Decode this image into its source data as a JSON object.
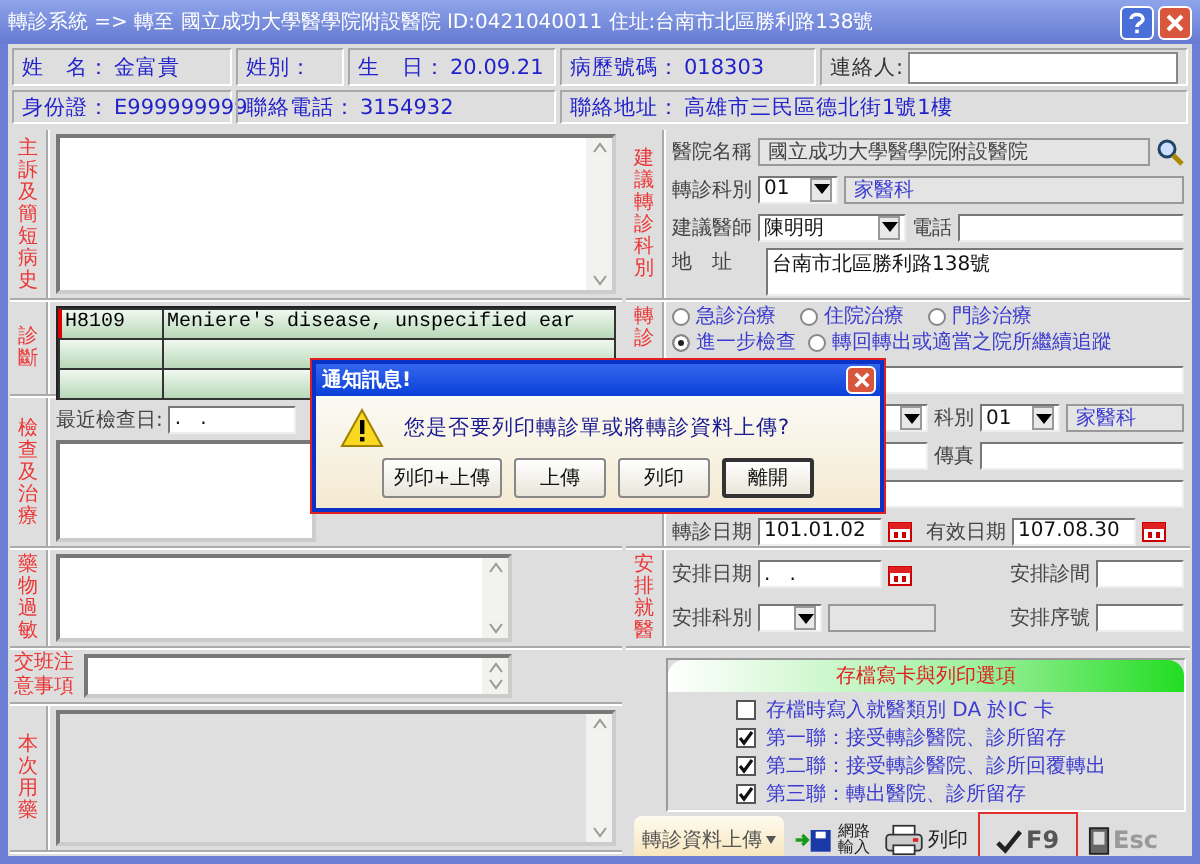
{
  "window": {
    "title": "轉診系統 => 轉至 國立成功大學醫學院附設醫院 ID:0421040011 住址:台南市北區勝利路138號"
  },
  "info_rows": [
    [
      {
        "kind": "text",
        "label": "姓　名：",
        "value": "金富貴"
      },
      {
        "kind": "text",
        "label": "姓別："
      },
      {
        "kind": "text",
        "label": "生　日：",
        "value": "20.09.21"
      },
      {
        "kind": "text",
        "label": "病歷號碼：",
        "value": "018303"
      },
      {
        "kind": "input",
        "label": "連絡人:"
      }
    ],
    [
      {
        "kind": "text",
        "label": "身份證：",
        "value": "E999999999"
      },
      {
        "kind": "text",
        "label": "聯絡電話：",
        "value": "3154932"
      },
      {
        "kind": "text",
        "label": "聯絡地址：",
        "value": "高雄市三民區德北街1號1樓"
      }
    ]
  ],
  "complaint": {
    "label": "主訴及簡短病史"
  },
  "diagnosis": {
    "label": "診斷",
    "rows": [
      {
        "code": "H8109",
        "description": "Meniere's disease, unspecified ear"
      }
    ]
  },
  "exam": {
    "label": "檢查及治療",
    "last_date_label": "最近檢查日:",
    "last_date": ".   ."
  },
  "allergy": {
    "label": "藥物過敏"
  },
  "handover": {
    "label": "交班注意事項"
  },
  "medication": {
    "label": "本次用藥"
  },
  "referral": {
    "label": "建議轉診科別",
    "hospital_label": "醫院名稱",
    "hospital": "國立成功大學醫學院附設醫院",
    "dept_label": "轉診科別",
    "dept_code": "01",
    "dept_name": "家醫科",
    "doctor_label": "建議醫師",
    "doctor": "陳明明",
    "phone_label": "電話",
    "address_label": "地　址",
    "address": "台南市北區勝利路138號"
  },
  "purpose": {
    "label": "轉診",
    "options": [
      {
        "label": "急診治療",
        "selected": false
      },
      {
        "label": "住院治療",
        "selected": false
      },
      {
        "label": "門診治療",
        "selected": false
      },
      {
        "label": "進一步檢查",
        "selected": true
      },
      {
        "label": "轉回轉出或適當之院所繼續追蹤",
        "selected": false
      }
    ],
    "dept_label": "科別",
    "dept_code": "01",
    "dept_name": "家醫科",
    "fax_label": "傳真",
    "referral_date_label": "轉診日期",
    "referral_date": "101.01.02",
    "valid_date_label": "有效日期",
    "valid_date": "107.08.30"
  },
  "arrangement": {
    "label": "安排就醫",
    "date_label": "安排日期",
    "date": ".   .",
    "room_label": "安排診間",
    "dept_label": "安排科別",
    "number_label": "安排序號"
  },
  "print_options": {
    "title": "存檔寫卡與列印選項",
    "items": [
      {
        "label": "存檔時寫入就醫類別 DA 於IC 卡",
        "checked": false
      },
      {
        "label": "第一聯：接受轉診醫院、診所留存",
        "checked": true
      },
      {
        "label": "第二聯：接受轉診醫院、診所回覆轉出",
        "checked": true
      },
      {
        "label": "第三聯：轉出醫院、診所留存",
        "checked": true
      }
    ]
  },
  "toolbar": [
    {
      "kind": "dropdown",
      "label": "轉診資料上傳"
    },
    {
      "kind": "network",
      "label": "網路輸入"
    },
    {
      "kind": "print",
      "label": "列印"
    },
    {
      "kind": "confirm",
      "label": "F9",
      "focused": true
    },
    {
      "kind": "exit",
      "label": "Esc",
      "disabled": true
    }
  ],
  "dialog": {
    "title": "通知訊息!",
    "message": "您是否要列印轉診單或將轉診資料上傳?",
    "buttons": [
      {
        "label": "列印+上傳",
        "default": false
      },
      {
        "label": "上傳",
        "default": false
      },
      {
        "label": "列印",
        "default": false
      },
      {
        "label": "離開",
        "default": true
      }
    ]
  }
}
